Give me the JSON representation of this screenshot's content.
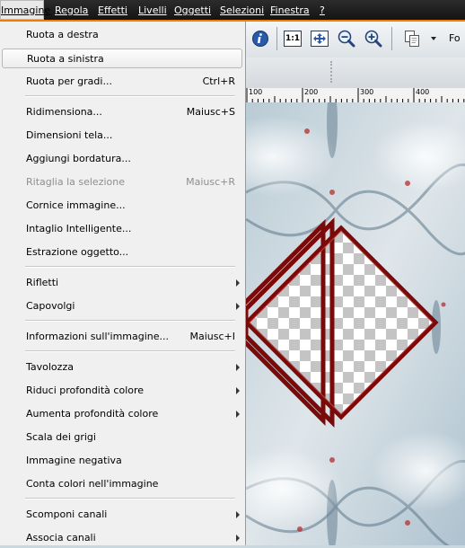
{
  "menubar": {
    "items": [
      {
        "label": "Immagine",
        "active": true
      },
      {
        "label": "Regola"
      },
      {
        "label": "Effetti"
      },
      {
        "label": "Livelli"
      },
      {
        "label": "Oggetti"
      },
      {
        "label": "Selezioni"
      },
      {
        "label": "Finestra"
      },
      {
        "label": "?"
      }
    ]
  },
  "toolbar": {
    "info_icon": "info-icon",
    "actual_size_label": "1:1",
    "fit_icon": "fit-window-icon",
    "zoom_out_icon": "zoom-out-icon",
    "zoom_in_icon": "zoom-in-icon",
    "copy_icon": "copy-icon",
    "cut_off_label": "Fo"
  },
  "ruler": {
    "labels": [
      "100",
      "200",
      "300",
      "400"
    ]
  },
  "menu": {
    "items": [
      {
        "label": "Ruota a destra",
        "shortcut": ""
      },
      {
        "label": "Ruota a sinistra",
        "shortcut": "",
        "highlighted": true
      },
      {
        "label": "Ruota per gradi...",
        "shortcut": "Ctrl+R"
      },
      {
        "label": "Ridimensiona...",
        "shortcut": "Maiusc+S"
      },
      {
        "label": "Dimensioni tela...",
        "shortcut": ""
      },
      {
        "label": "Aggiungi bordatura...",
        "shortcut": ""
      },
      {
        "label": "Ritaglia la selezione",
        "shortcut": "Maiusc+R",
        "disabled": true
      },
      {
        "label": "Cornice immagine...",
        "shortcut": ""
      },
      {
        "label": "Intaglio Intelligente...",
        "shortcut": ""
      },
      {
        "label": "Estrazione oggetto...",
        "shortcut": ""
      },
      {
        "label": "Rifletti",
        "submenu": true
      },
      {
        "label": "Capovolgi",
        "submenu": true
      },
      {
        "label": "Informazioni sull'immagine...",
        "shortcut": "Maiusc+I"
      },
      {
        "label": "Tavolozza",
        "submenu": true
      },
      {
        "label": "Riduci profondità colore",
        "submenu": true
      },
      {
        "label": "Aumenta profondità colore",
        "submenu": true
      },
      {
        "label": "Scala dei grigi",
        "shortcut": ""
      },
      {
        "label": "Immagine negativa",
        "shortcut": ""
      },
      {
        "label": "Conta colori nell'immagine",
        "shortcut": ""
      },
      {
        "label": "Scomponi canali",
        "submenu": true
      },
      {
        "label": "Associa canali",
        "submenu": true
      }
    ]
  },
  "colors": {
    "menubar_bg": "#1e1e1e",
    "menubar_accent": "#f07c00",
    "frame_red": "#7a0a0a",
    "menu_bg": "#f0f0f0"
  }
}
